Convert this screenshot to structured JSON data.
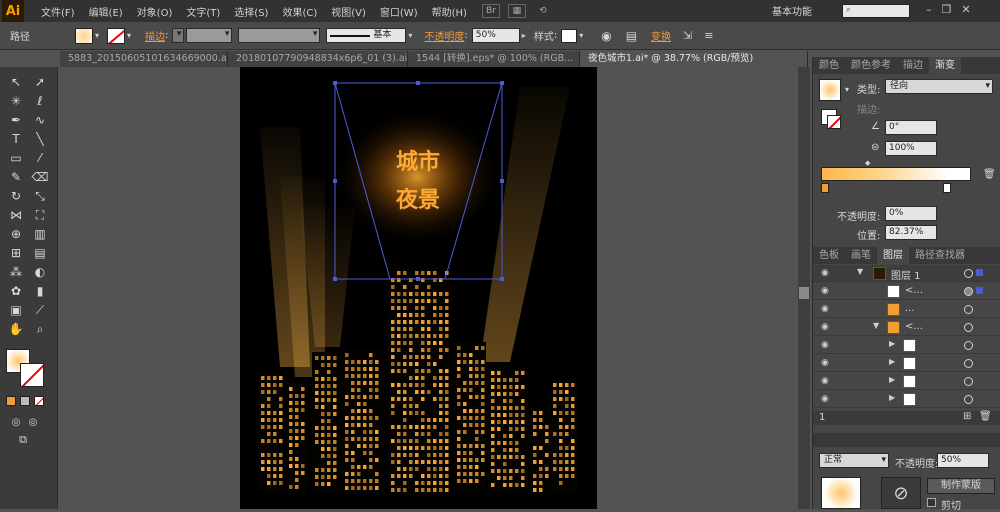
{
  "app": {
    "logo": "Ai"
  },
  "menu": [
    "文件(F)",
    "编辑(E)",
    "对象(O)",
    "文字(T)",
    "选择(S)",
    "效果(C)",
    "视图(V)",
    "窗口(W)",
    "帮助(H)"
  ],
  "workspace": "基本功能",
  "control": {
    "path_label": "路径",
    "stroke_label": "描边",
    "stroke_profile": "基本",
    "opacity_label": "不透明度",
    "opacity_value": "50%",
    "style_label": "样式",
    "transform_label": "变换"
  },
  "tabs": [
    "5883_20150605101634669000.ai*",
    "20180107790948834x6p6_01 (3).ai*",
    "1544 [转换].eps* @ 100% (RGB...",
    "夜色城市1.ai* @ 38.77% (RGB/预览)"
  ],
  "artwork": {
    "title_line1": "城市",
    "title_line2": "夜景"
  },
  "gradient_panel": {
    "tabs": [
      "颜色",
      "颜色参考",
      "描边",
      "渐变"
    ],
    "type_label": "类型",
    "type_value": "径向",
    "stroke_label": "描边",
    "angle_value": "0°",
    "aspect_value": "100%",
    "opacity_label": "不透明度",
    "opacity_value": "0%",
    "location_label": "位置",
    "location_value": "82.37%"
  },
  "layers_panel": {
    "tabs": [
      "色板",
      "画笔",
      "图层",
      "路径查找器"
    ],
    "layer1_name": "图层 1",
    "sub1": "<...",
    "sub2": "...",
    "sub3": "<...",
    "footer_count": "1"
  },
  "transparency": {
    "mode": "正常",
    "opacity_label": "不透明度",
    "opacity_value": "50%",
    "mask_button": "制作蒙版",
    "clip_label": "剪切"
  },
  "colors": {
    "accent": "#f29a3a",
    "window_light": "#ffa935"
  }
}
